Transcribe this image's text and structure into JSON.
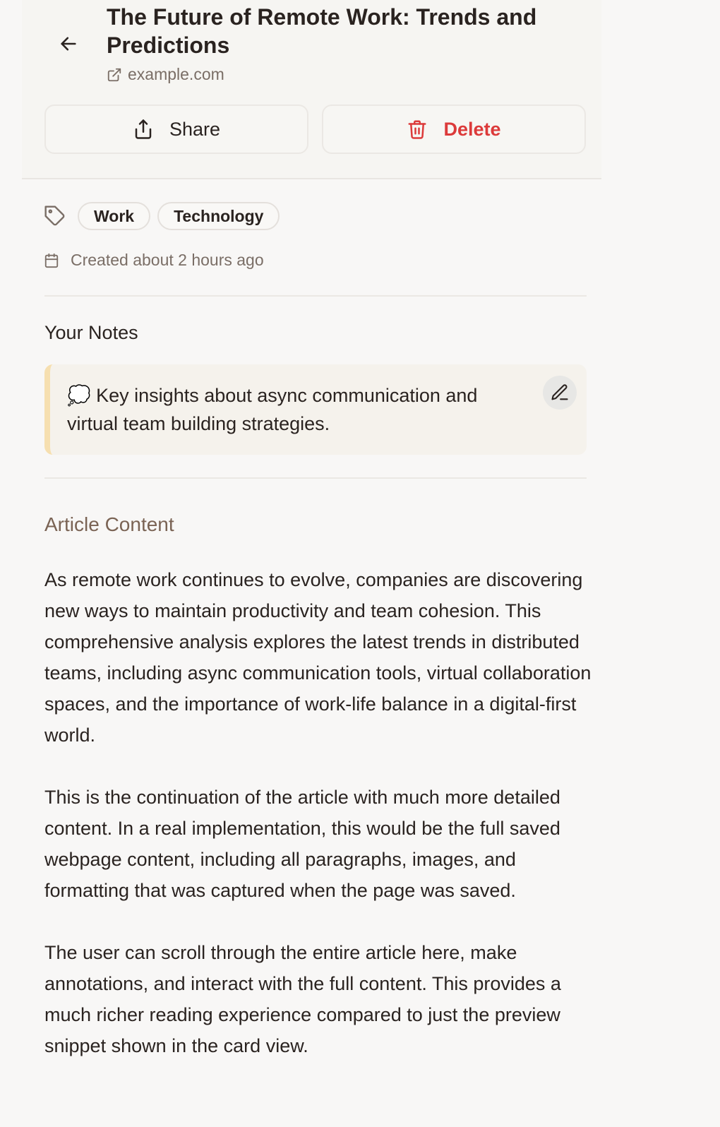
{
  "header": {
    "title": "The Future of Remote Work: Trends and Predictions",
    "domain": "example.com",
    "icons": {
      "back": "arrow-left-icon",
      "external_link": "external-link-icon"
    }
  },
  "actions": {
    "share_label": "Share",
    "delete_label": "Delete",
    "icons": {
      "share": "share-icon",
      "delete": "trash-icon"
    }
  },
  "tags": [
    "Work",
    "Technology"
  ],
  "meta": {
    "created": "Created about 2 hours ago"
  },
  "notes": {
    "heading": "Your Notes",
    "emoji": "💭",
    "text": "Key insights about async communication and virtual team building strategies."
  },
  "article": {
    "heading": "Article Content",
    "paragraphs": [
      "As remote work continues to evolve, companies are discovering new ways to maintain productivity and team cohesion. This comprehensive analysis explores the latest trends in distributed teams, including async communication tools, virtual collaboration spaces, and the importance of work-life balance in a digital-first world.",
      "This is the continuation of the article with much more detailed content. In a real implementation, this would be the full saved webpage content, including all paragraphs, images, and formatting that was captured when the page was saved.",
      "The user can scroll through the entire article here, make annotations, and interact with the full content. This provides a much richer reading experience compared to just the preview snippet shown in the card view."
    ]
  },
  "colors": {
    "background": "#f8f7f6",
    "header_background": "#f6f5f2",
    "text": "#2a2320",
    "muted": "#7a6e66",
    "danger": "#dc3a3a",
    "notes_accent": "#f6dfb0",
    "section_heading": "#7a6354"
  }
}
